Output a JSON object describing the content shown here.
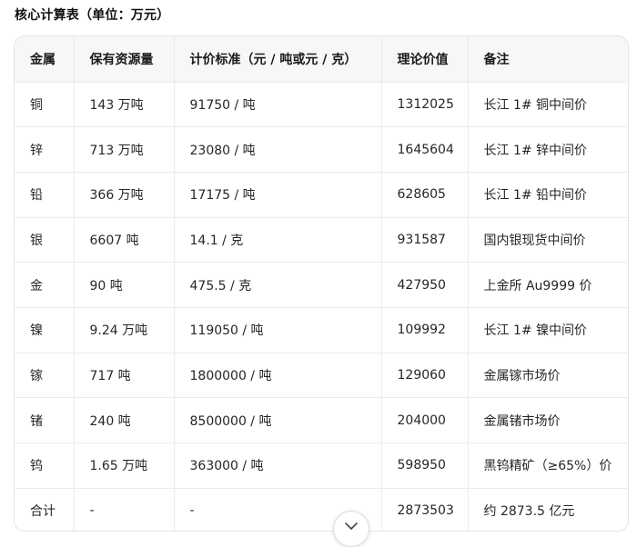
{
  "title": "核心计算表（单位：万元）",
  "table": {
    "headers": [
      "金属",
      "保有资源量",
      "计价标准（元 / 吨或元 / 克）",
      "理论价值",
      "备注"
    ],
    "rows": [
      [
        "铜",
        "143 万吨",
        "91750 / 吨",
        "1312025",
        "长江 1# 铜中间价"
      ],
      [
        "锌",
        "713 万吨",
        "23080 / 吨",
        "1645604",
        "长江 1# 锌中间价"
      ],
      [
        "铅",
        "366 万吨",
        "17175 / 吨",
        "628605",
        "长江 1# 铅中间价"
      ],
      [
        "银",
        "6607 吨",
        "14.1 / 克",
        "931587",
        "国内银现货中间价"
      ],
      [
        "金",
        "90 吨",
        "475.5 / 克",
        "427950",
        "上金所 Au9999 价"
      ],
      [
        "镍",
        "9.24 万吨",
        "119050 / 吨",
        "109992",
        "长江 1# 镍中间价"
      ],
      [
        "镓",
        "717 吨",
        "1800000 / 吨",
        "129060",
        "金属镓市场价"
      ],
      [
        "锗",
        "240 吨",
        "8500000 / 吨",
        "204000",
        "金属锗市场价"
      ],
      [
        "钨",
        "1.65 万吨",
        "363000 / 吨",
        "598950",
        "黑钨精矿（≥65%）价"
      ],
      [
        "合计",
        "-",
        "-",
        "2873503",
        "约 2873.5 亿元"
      ]
    ]
  },
  "scroll_button": {
    "icon": "chevron-down-icon"
  }
}
